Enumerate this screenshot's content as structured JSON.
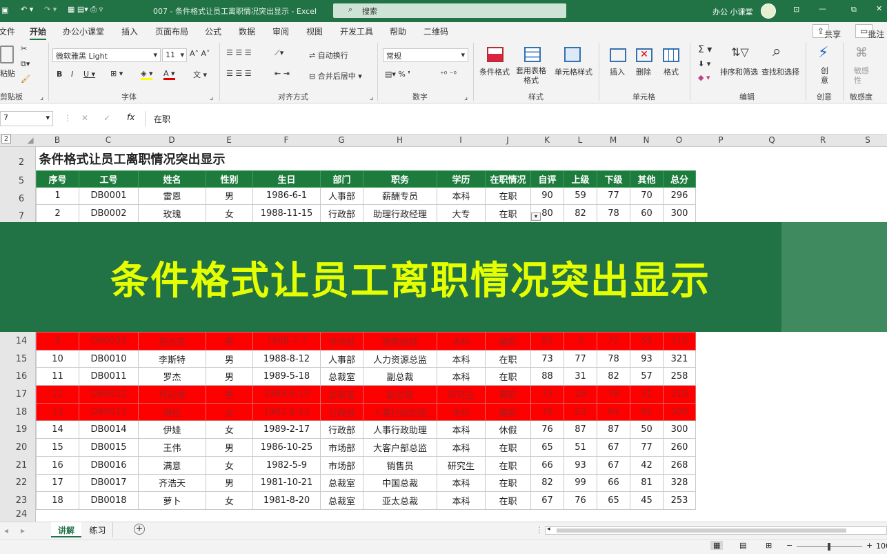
{
  "window": {
    "title": "007 - 条件格式让员工离职情况突出显示 - Excel",
    "search": "搜索",
    "user": "办公 小课堂"
  },
  "tabs": [
    "文件",
    "开始",
    "办公小课堂",
    "插入",
    "页面布局",
    "公式",
    "数据",
    "审阅",
    "视图",
    "开发工具",
    "帮助",
    "二维码"
  ],
  "tabs_right": {
    "share": "共享",
    "comments": "批注"
  },
  "ribbon": {
    "clipboard": {
      "paste": "粘贴",
      "group": "剪贴板"
    },
    "font": {
      "name": "微软雅黑 Light",
      "size": "11",
      "group": "字体"
    },
    "align": {
      "wrap": "自动换行",
      "merge": "合并后居中",
      "group": "对齐方式"
    },
    "number": {
      "format": "常规",
      "group": "数字"
    },
    "styles": {
      "cond": "条件格式",
      "table": "套用表格格式",
      "cell": "单元格样式",
      "group": "样式"
    },
    "cells": {
      "insert": "插入",
      "delete": "删除",
      "format": "格式",
      "group": "单元格"
    },
    "editing": {
      "sort": "排序和筛选",
      "find": "查找和选择",
      "group": "编辑"
    },
    "creative": {
      "btn": "创意",
      "group": "创意"
    },
    "sensitivity": {
      "btn": "敏感性",
      "group": "敏感度"
    }
  },
  "formula": {
    "name_box": "7",
    "content": "在职"
  },
  "columns": [
    "B",
    "C",
    "D",
    "E",
    "F",
    "G",
    "H",
    "I",
    "J",
    "K",
    "L",
    "M",
    "N",
    "O",
    "P",
    "Q",
    "R",
    "S"
  ],
  "row_numbers": [
    "2",
    "5",
    "6",
    "7",
    "14",
    "15",
    "16",
    "17",
    "18",
    "19",
    "20",
    "21",
    "22",
    "23",
    "24"
  ],
  "sheet_title": "条件格式让员工离职情况突出显示",
  "headers": [
    "序号",
    "工号",
    "姓名",
    "性别",
    "生日",
    "部门",
    "职务",
    "学历",
    "在职情况",
    "自评",
    "上级",
    "下级",
    "其他",
    "总分"
  ],
  "rows_top": [
    [
      "1",
      "DB0001",
      "雷恩",
      "男",
      "1986-6-1",
      "人事部",
      "薪酬专员",
      "本科",
      "在职",
      "90",
      "59",
      "77",
      "70",
      "296"
    ],
    [
      "2",
      "DB0002",
      "玫瑰",
      "女",
      "1988-11-15",
      "行政部",
      "助理行政经理",
      "大专",
      "在职",
      "80",
      "82",
      "78",
      "60",
      "300"
    ]
  ],
  "rows_bottom": [
    [
      "9",
      "DB0009",
      "屈杰克",
      "男",
      "1988-7-7",
      "市场部",
      "销售经理",
      "本科",
      "离职",
      "85",
      "0",
      "72",
      "59",
      "216"
    ],
    [
      "10",
      "DB0010",
      "李斯特",
      "男",
      "1988-8-12",
      "人事部",
      "人力资源总监",
      "本科",
      "在职",
      "73",
      "77",
      "78",
      "93",
      "321"
    ],
    [
      "11",
      "DB0011",
      "罗杰",
      "男",
      "1989-5-18",
      "总裁室",
      "副总裁",
      "本科",
      "在职",
      "88",
      "31",
      "82",
      "57",
      "258"
    ],
    [
      "12",
      "DB0012",
      "柯必得",
      "男",
      "1989-9-10",
      "总裁室",
      "副总裁",
      "研究生",
      "离职",
      "73",
      "28",
      "78",
      "31",
      "210"
    ],
    [
      "13",
      "DB0013",
      "海伦",
      "女",
      "1982-8-23",
      "行政部",
      "人事行政助理",
      "本科",
      "离职",
      "76",
      "63",
      "69",
      "92",
      "300"
    ],
    [
      "14",
      "DB0014",
      "伊娃",
      "女",
      "1989-2-17",
      "行政部",
      "人事行政助理",
      "本科",
      "休假",
      "76",
      "87",
      "87",
      "50",
      "300"
    ],
    [
      "15",
      "DB0015",
      "王伟",
      "男",
      "1986-10-25",
      "市场部",
      "大客户部总监",
      "本科",
      "在职",
      "65",
      "51",
      "67",
      "77",
      "260"
    ],
    [
      "16",
      "DB0016",
      "满意",
      "女",
      "1982-5-9",
      "市场部",
      "销售员",
      "研究生",
      "在职",
      "66",
      "93",
      "67",
      "42",
      "268"
    ],
    [
      "17",
      "DB0017",
      "齐浩天",
      "男",
      "1981-10-21",
      "总裁室",
      "中国总裁",
      "本科",
      "在职",
      "82",
      "99",
      "66",
      "81",
      "328"
    ],
    [
      "18",
      "DB0018",
      "萝卜",
      "女",
      "1981-8-20",
      "总裁室",
      "亚太总裁",
      "本科",
      "在职",
      "67",
      "76",
      "65",
      "45",
      "253"
    ]
  ],
  "banner": "条件格式让员工离职情况突出显示",
  "sheets": [
    "讲解",
    "练习"
  ],
  "status": {
    "zoom": "100"
  },
  "colors": {
    "excel_green": "#217346",
    "header_green": "#1e7b3e",
    "highlight_red": "#ff0000",
    "banner_text": "#e6ff00"
  }
}
